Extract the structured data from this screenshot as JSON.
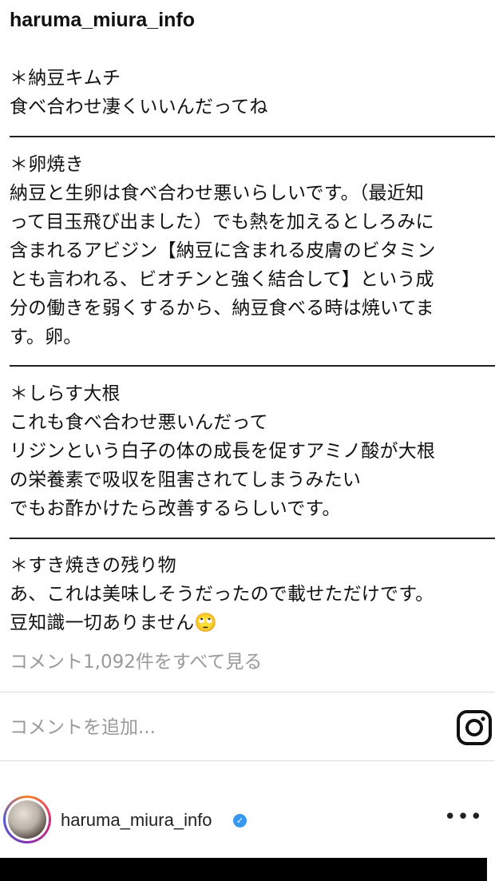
{
  "caption": {
    "username": "haruma_miura_info",
    "sections": [
      {
        "heading": "＊納豆キムチ",
        "lines": [
          "食べ合わせ凄くいいんだってね"
        ]
      },
      {
        "heading": "＊卵焼き",
        "lines": [
          "納豆と生卵は食べ合わせ悪いらしいです。（最近知",
          "って目玉飛び出ました）でも熱を加えるとしろみに",
          "含まれるアビジン【納豆に含まれる皮膚のビタミン",
          "とも言われる、ビオチンと強く結合して】という成",
          "分の働きを弱くするから、納豆食べる時は焼いてま",
          "す。卵。"
        ]
      },
      {
        "heading": "＊しらす大根",
        "lines": [
          "これも食べ合わせ悪いんだって",
          "リジンという白子の体の成長を促すアミノ酸が大根",
          "の栄養素で吸収を阻害されてしまうみたい",
          "でもお酢かけたら改善するらしいです。"
        ]
      },
      {
        "heading": "＊すき焼きの残り物",
        "lines": [
          "あ、これは美味しそうだったので載せただけです。",
          "豆知識一切ありません🙄"
        ]
      }
    ]
  },
  "comments": {
    "view_all_label": "コメント1,092件をすべて見る",
    "add_placeholder": "コメントを追加..."
  },
  "icons": {
    "instagram": "instagram-icon",
    "verified": "verified-badge-icon",
    "more": "more-options-icon"
  },
  "next_post": {
    "username": "haruma_miura_info",
    "more_label": "•••"
  },
  "colors": {
    "text": "#111111",
    "muted": "#9a9a9a",
    "verified": "#3897f0"
  }
}
